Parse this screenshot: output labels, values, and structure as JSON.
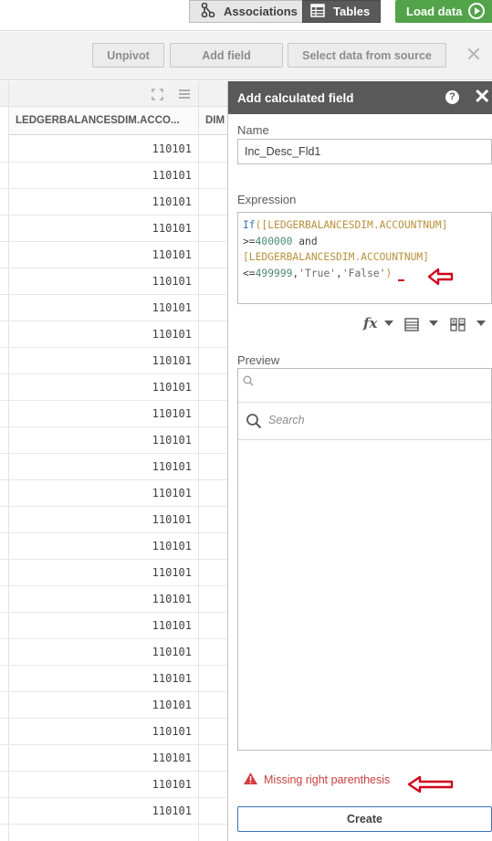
{
  "topbar": {
    "associations_label": "Associations",
    "tables_label": "Tables",
    "load_data_label": "Load data"
  },
  "toolbar": {
    "unpivot_label": "Unpivot",
    "add_field_label": "Add field",
    "select_data_label": "Select data from source"
  },
  "table": {
    "columns": [
      "LEDGERBALANCESDIM.ACCO...",
      "DIM"
    ],
    "rows": [
      "110101",
      "110101",
      "110101",
      "110101",
      "110101",
      "110101",
      "110101",
      "110101",
      "110101",
      "110101",
      "110101",
      "110101",
      "110101",
      "110101",
      "110101",
      "110101",
      "110101",
      "110101",
      "110101",
      "110101",
      "110101",
      "110101",
      "110101",
      "110101",
      "110101",
      "110101"
    ]
  },
  "panel": {
    "title": "Add calculated field",
    "name_label": "Name",
    "name_value": "Inc_Desc_Fld1",
    "expression_label": "Expression",
    "expression": {
      "fn": "If",
      "open_paren": "(",
      "field1": "[LEDGERBALANCESDIM.ACCOUNTNUM]",
      "op1": ">=",
      "num1": "400000",
      "and": " and",
      "field2": "[LEDGERBALANCESDIM.ACCOUNTNUM]",
      "op2": "<=",
      "num2": "499999",
      "comma1": ",",
      "str1": "'True'",
      "comma2": ",",
      "str2": "'False'",
      "close_paren": ")"
    },
    "preview_label": "Preview",
    "search_placeholder": "Search",
    "error_message": "Missing right parenthesis",
    "create_label": "Create"
  },
  "colors": {
    "header_dark": "#595959",
    "load_green": "#52a34a",
    "error_red": "#c94040",
    "annotation_red": "#d0021b",
    "create_border": "#3b73b9"
  }
}
